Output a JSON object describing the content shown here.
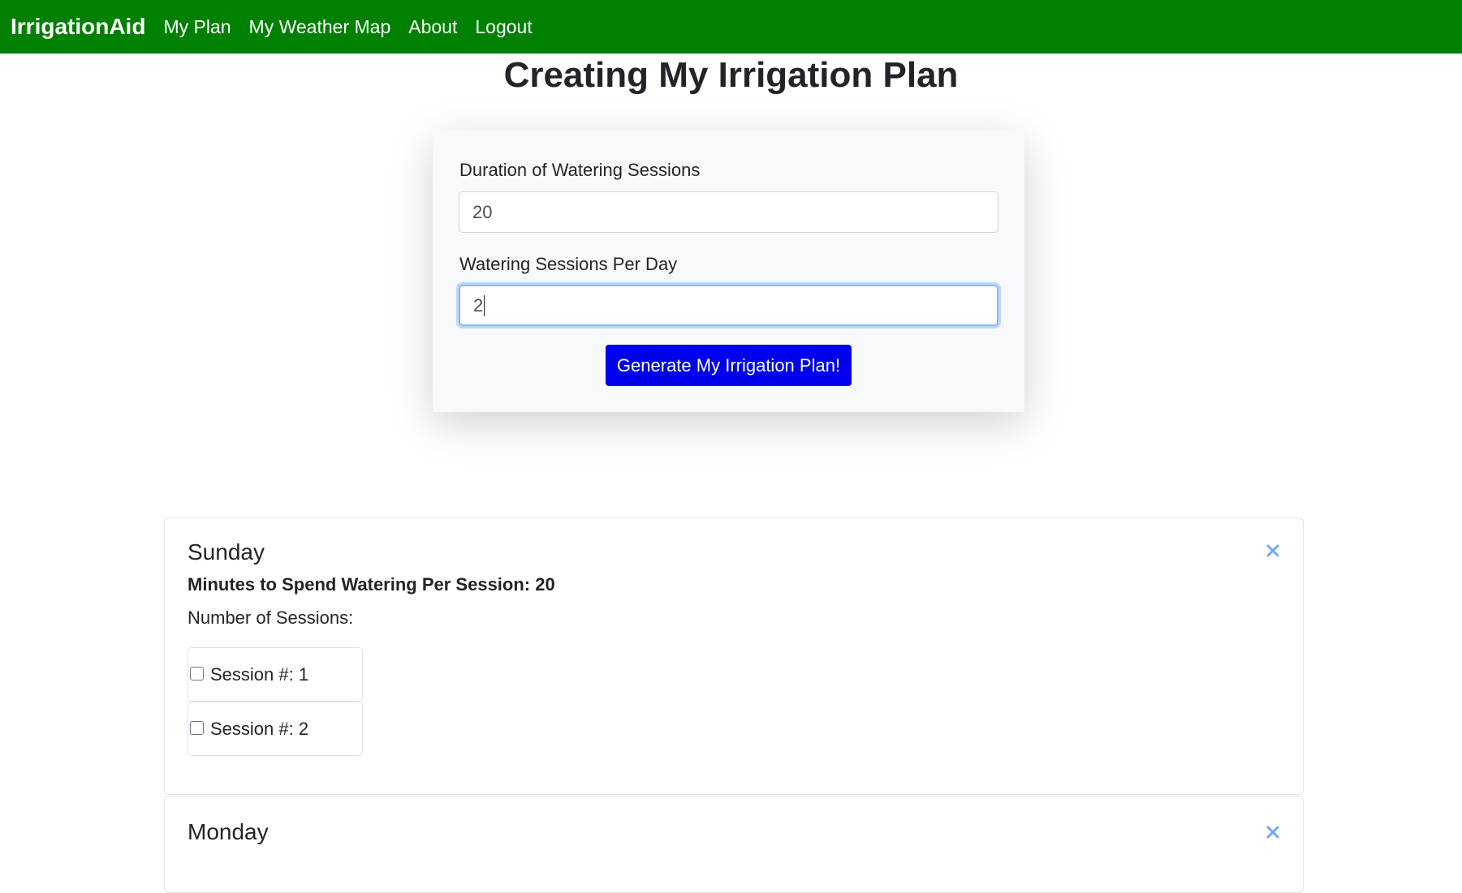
{
  "navbar": {
    "brand": "IrrigationAid",
    "links": [
      "My Plan",
      "My Weather Map",
      "About",
      "Logout"
    ]
  },
  "page": {
    "title": "Creating My Irrigation Plan"
  },
  "form": {
    "duration_label": "Duration of Watering Sessions",
    "duration_value": "20",
    "sessions_label": "Watering Sessions Per Day",
    "sessions_value": "2",
    "submit_label": "Generate My Irrigation Plan!"
  },
  "days": [
    {
      "name": "Sunday",
      "minutes_text": "Minutes to Spend Watering Per Session: 20",
      "sessions_heading": "Number of Sessions:",
      "sessions": [
        "Session #: 1",
        "Session #: 2"
      ]
    },
    {
      "name": "Monday"
    }
  ],
  "colors": {
    "navbar": "#008000",
    "button": "#0000ee",
    "close_icon": "#6ea8fe"
  },
  "icons": {
    "close": "close-icon"
  }
}
